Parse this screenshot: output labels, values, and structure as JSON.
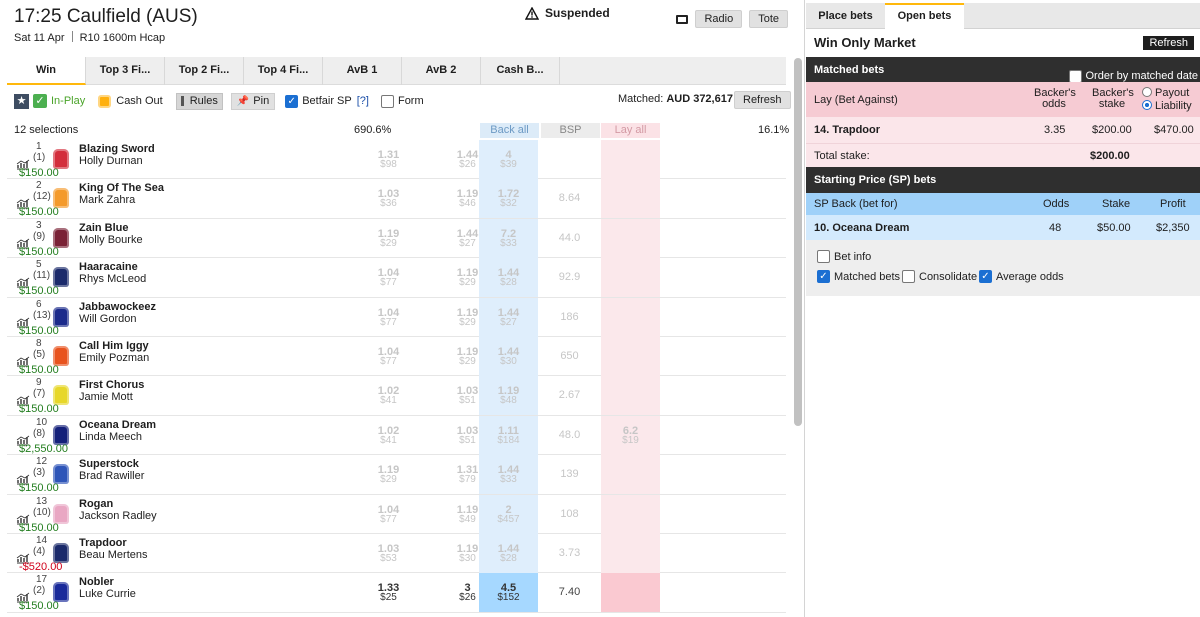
{
  "header": {
    "title": "17:25 Caulfield (AUS)",
    "date": "Sat 11 Apr",
    "race": "R10 1600m Hcap",
    "radio_label": "Radio",
    "tote_label": "Tote"
  },
  "market_tabs": [
    "Win",
    "Top 3 Fi...",
    "Top 2 Fi...",
    "Top 4 Fi...",
    "AvB 1",
    "AvB 2",
    "Cash B..."
  ],
  "toolbar": {
    "inplay": "In-Play",
    "cashout": "Cash Out",
    "rules": "Rules",
    "pin": "Pin",
    "betfair_sp": "Betfair SP",
    "help": "[?]",
    "form": "Form",
    "matched_label": "Matched:",
    "matched_value": "AUD 372,617",
    "refresh": "Refresh"
  },
  "columns": {
    "selections": "12 selections",
    "back_pct": "690.6%",
    "back_all": "Back all",
    "bsp": "BSP",
    "lay_all": "Lay all",
    "lay_pct": "16.1%"
  },
  "suspended_label": "Suspended",
  "runners": [
    {
      "num": "1",
      "draw": "(1)",
      "name": "Blazing Sword",
      "jockey": "Holly Durnan",
      "pl": "$150.00",
      "neg": false,
      "silk": "#d32e3c",
      "b3": [
        "1.31",
        "$98"
      ],
      "b2": [
        "1.44",
        "$26"
      ],
      "b1": [
        "4",
        "$39"
      ],
      "bsp": "",
      "lay": [
        "",
        ""
      ]
    },
    {
      "num": "2",
      "draw": "(12)",
      "name": "King Of The Sea",
      "jockey": "Mark Zahra",
      "pl": "$150.00",
      "neg": false,
      "silk": "#f49a2b",
      "b3": [
        "1.03",
        "$36"
      ],
      "b2": [
        "1.19",
        "$46"
      ],
      "b1": [
        "1.72",
        "$32"
      ],
      "bsp": "8.64",
      "lay": [
        "",
        ""
      ]
    },
    {
      "num": "3",
      "draw": "(9)",
      "name": "Zain Blue",
      "jockey": "Molly Bourke",
      "pl": "$150.00",
      "neg": false,
      "silk": "#7a2236",
      "b3": [
        "1.19",
        "$29"
      ],
      "b2": [
        "1.44",
        "$27"
      ],
      "b1": [
        "7.2",
        "$33"
      ],
      "bsp": "44.0",
      "lay": [
        "",
        ""
      ]
    },
    {
      "num": "5",
      "draw": "(11)",
      "name": "Haaracaine",
      "jockey": "Rhys McLeod",
      "pl": "$150.00",
      "neg": false,
      "silk": "#1b2a6b",
      "b3": [
        "1.04",
        "$77"
      ],
      "b2": [
        "1.19",
        "$29"
      ],
      "b1": [
        "1.44",
        "$28"
      ],
      "bsp": "92.9",
      "lay": [
        "",
        ""
      ]
    },
    {
      "num": "6",
      "draw": "(13)",
      "name": "Jabbawockeez",
      "jockey": "Will Gordon",
      "pl": "$150.00",
      "neg": false,
      "silk": "#1b2a8b",
      "b3": [
        "1.04",
        "$77"
      ],
      "b2": [
        "1.19",
        "$29"
      ],
      "b1": [
        "1.44",
        "$27"
      ],
      "bsp": "186",
      "lay": [
        "",
        ""
      ]
    },
    {
      "num": "8",
      "draw": "(5)",
      "name": "Call Him Iggy",
      "jockey": "Emily Pozman",
      "pl": "$150.00",
      "neg": false,
      "silk": "#e8531e",
      "b3": [
        "1.04",
        "$77"
      ],
      "b2": [
        "1.19",
        "$29"
      ],
      "b1": [
        "1.44",
        "$30"
      ],
      "bsp": "650",
      "lay": [
        "",
        ""
      ]
    },
    {
      "num": "9",
      "draw": "(7)",
      "name": "First Chorus",
      "jockey": "Jamie Mott",
      "pl": "$150.00",
      "neg": false,
      "silk": "#e7d72a",
      "b3": [
        "1.02",
        "$41"
      ],
      "b2": [
        "1.03",
        "$51"
      ],
      "b1": [
        "1.19",
        "$48"
      ],
      "bsp": "2.67",
      "lay": [
        "",
        ""
      ]
    },
    {
      "num": "10",
      "draw": "(8)",
      "name": "Oceana Dream",
      "jockey": "Linda Meech",
      "pl": "$2,550.00",
      "neg": false,
      "silk": "#14207a",
      "b3": [
        "1.02",
        "$41"
      ],
      "b2": [
        "1.03",
        "$51"
      ],
      "b1": [
        "1.11",
        "$184"
      ],
      "bsp": "48.0",
      "lay": [
        "6.2",
        "$19"
      ]
    },
    {
      "num": "12",
      "draw": "(3)",
      "name": "Superstock",
      "jockey": "Brad Rawiller",
      "pl": "$150.00",
      "neg": false,
      "silk": "#2e55b8",
      "b3": [
        "1.19",
        "$29"
      ],
      "b2": [
        "1.31",
        "$79"
      ],
      "b1": [
        "1.44",
        "$33"
      ],
      "bsp": "139",
      "lay": [
        "",
        ""
      ]
    },
    {
      "num": "13",
      "draw": "(10)",
      "name": "Rogan",
      "jockey": "Jackson Radley",
      "pl": "$150.00",
      "neg": false,
      "silk": "#e9a7c3",
      "b3": [
        "1.04",
        "$77"
      ],
      "b2": [
        "1.19",
        "$49"
      ],
      "b1": [
        "2",
        "$457"
      ],
      "bsp": "108",
      "lay": [
        "",
        ""
      ]
    },
    {
      "num": "14",
      "draw": "(4)",
      "name": "Trapdoor",
      "jockey": "Beau Mertens",
      "pl": "-$520.00",
      "neg": true,
      "silk": "#1b2a6b",
      "b3": [
        "1.03",
        "$53"
      ],
      "b2": [
        "1.19",
        "$30"
      ],
      "b1": [
        "1.44",
        "$28"
      ],
      "bsp": "3.73",
      "lay": [
        "",
        ""
      ]
    },
    {
      "num": "17",
      "draw": "(2)",
      "name": "Nobler",
      "jockey": "Luke Currie",
      "pl": "$150.00",
      "neg": false,
      "silk": "#1a2a9a",
      "b3": [
        "1.33",
        "$25"
      ],
      "b2": [
        "3",
        "$26"
      ],
      "b1": [
        "4.5",
        "$152"
      ],
      "bsp": "7.40",
      "lay": [
        "",
        ""
      ],
      "live": true
    }
  ],
  "side": {
    "tab_place": "Place bets",
    "tab_open": "Open bets",
    "market": "Win Only Market",
    "refresh": "Refresh",
    "matched_title": "Matched bets",
    "order_label": "Order by matched date",
    "lay_header": "Lay (Bet Against)",
    "backers_odds": "Backer's odds",
    "backers_stake": "Backer's stake",
    "payout": "Payout",
    "liability": "Liability",
    "lay_runner": "14. Trapdoor",
    "lay_odds": "3.35",
    "lay_stake": "$200.00",
    "lay_liability": "$470.00",
    "total_label": "Total stake:",
    "total_value": "$200.00",
    "sp_title": "Starting Price (SP) bets",
    "sp_header": "SP Back (bet for)",
    "sp_odds_h": "Odds",
    "sp_stake_h": "Stake",
    "sp_profit_h": "Profit",
    "sp_runner": "10. Oceana Dream",
    "sp_odds": "48",
    "sp_stake": "$50.00",
    "sp_profit": "$2,350",
    "bet_info": "Bet info",
    "matched_bets": "Matched bets",
    "consolidate": "Consolidate",
    "average_odds": "Average odds"
  },
  "colors": {
    "accent": "#ffb80c",
    "back": "#a6d8ff",
    "lay": "#fac9d1",
    "positive": "#237e1f",
    "negative": "#d0021b"
  }
}
